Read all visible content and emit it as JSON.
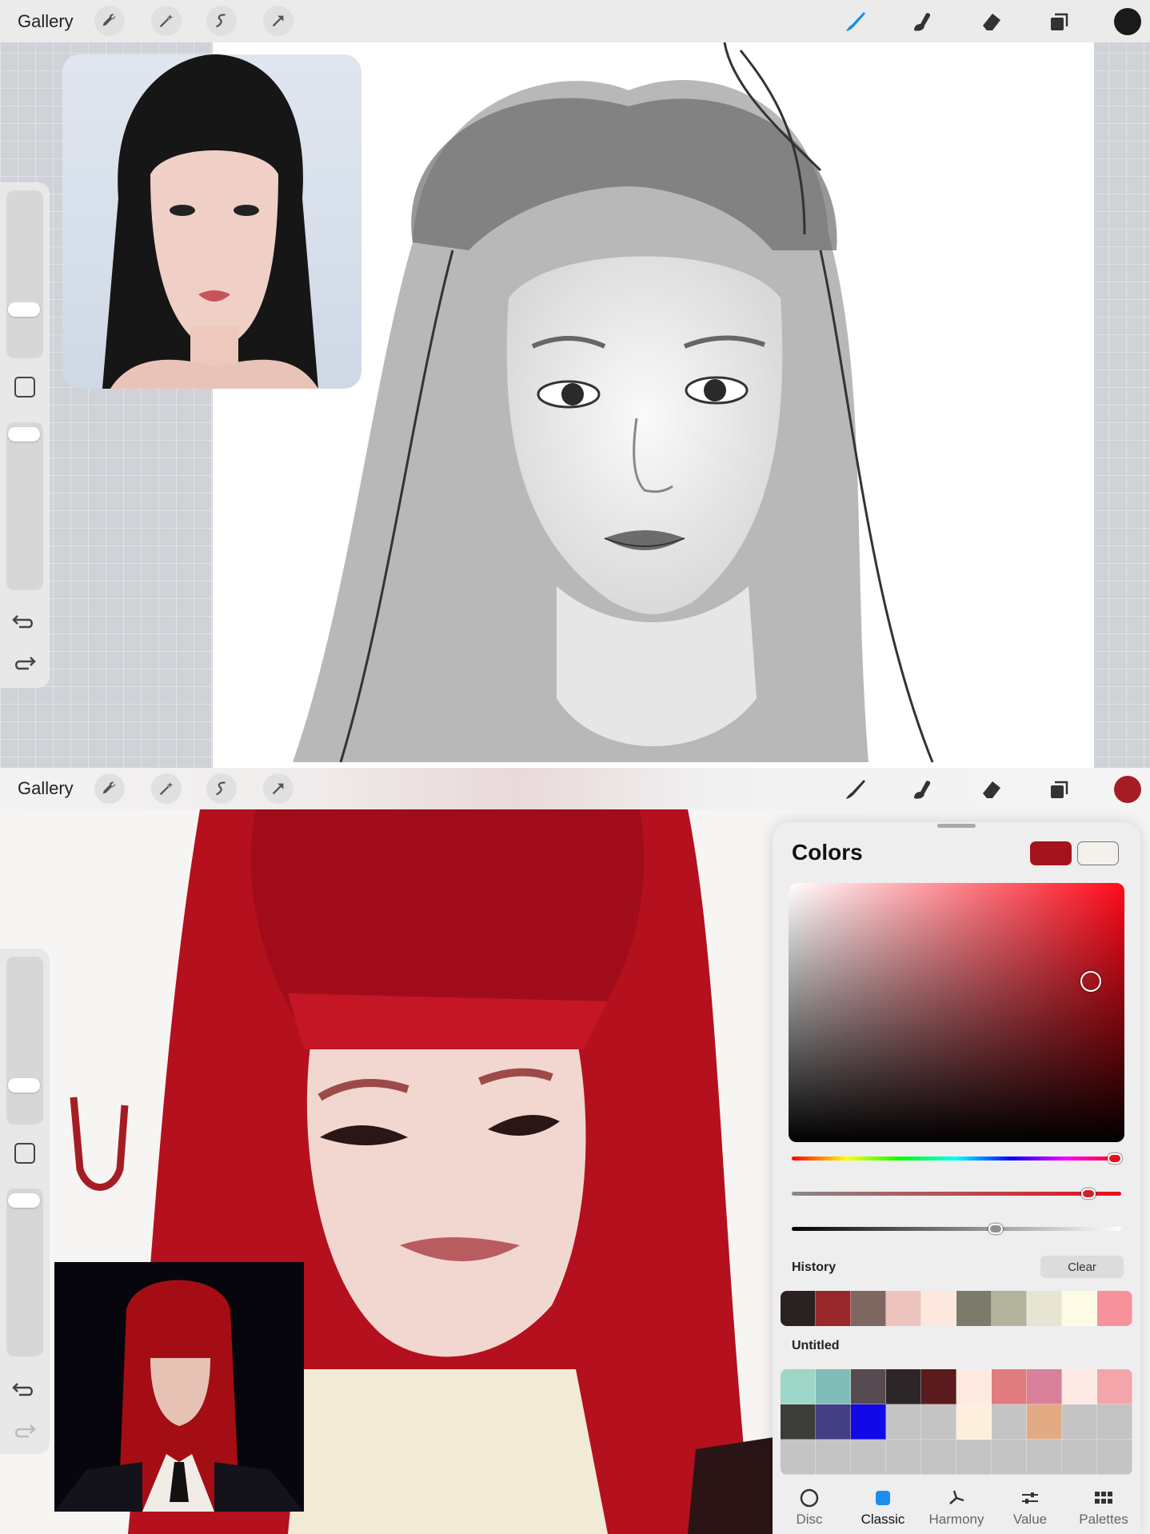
{
  "top": {
    "gallery_label": "Gallery",
    "brush_color": "#1a1a1a"
  },
  "bottom": {
    "gallery_label": "Gallery",
    "brush_color": "#a51d24"
  },
  "colors_panel": {
    "title": "Colors",
    "primary_color": "#a3141d",
    "secondary_color": "#f4f0ec",
    "history_label": "History",
    "clear_label": "Clear",
    "history_swatches": [
      "#2a2220",
      "#98282a",
      "#7e6661",
      "#edc4bd",
      "#fce8de",
      "#7b7a6b",
      "#b3b29d",
      "#e8e4d4",
      "#fdfbe5",
      "#f7929d"
    ],
    "palette_label": "Untitled",
    "palette_row1": [
      "#9dd5c6",
      "#82bcb8",
      "#574a50",
      "#2c2629",
      "#5a1a1e",
      "#fde9e0",
      "#e07c7d",
      "#d9809a",
      "#fdeae4",
      "#f4a5aa"
    ],
    "palette_row2": [
      "#3c3d38",
      "#443f85",
      "#1208e8",
      "#c4c4c4",
      "#c4c4c4",
      "#fdefdc",
      "#c4c4c4",
      "#e2ab84",
      "#c4c4c4",
      "#c4c4c4"
    ],
    "tabs": [
      {
        "label": "Disc",
        "icon": "disc-icon"
      },
      {
        "label": "Classic",
        "icon": "classic-square-icon"
      },
      {
        "label": "Harmony",
        "icon": "harmony-icon"
      },
      {
        "label": "Value",
        "icon": "sliders-icon"
      },
      {
        "label": "Palettes",
        "icon": "grid-icon"
      }
    ],
    "active_tab": "Classic",
    "hue": 0.98,
    "saturation": 0.9,
    "brightness": 0.62
  }
}
